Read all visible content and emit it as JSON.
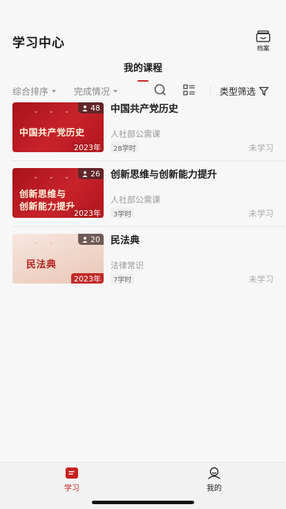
{
  "header": {
    "title": "学习中心",
    "archive_label": "档案"
  },
  "tabs": [
    {
      "label": "我的课程",
      "active": true
    }
  ],
  "filters": {
    "sort_label": "综合排序",
    "status_label": "完成情况",
    "type_filter_label": "类型筛选"
  },
  "courses": [
    {
      "title": "中国共产党历史",
      "thumb_text": "中国共产党历史",
      "category": "人社部公需课",
      "hours": "28学时",
      "status": "未学习",
      "learners": "48",
      "year": "2023年"
    },
    {
      "title": "创新思维与创新能力提升",
      "thumb_text_line1": "创新思维与",
      "thumb_text_line2": "创新能力提升",
      "category": "人社部公需课",
      "hours": "3学时",
      "status": "未学习",
      "learners": "26",
      "year": "2023年"
    },
    {
      "title": "民法典",
      "thumb_text": "民法典",
      "category": "法律常识",
      "hours": "7学时",
      "status": "未学习",
      "learners": "20",
      "year": "2023年"
    }
  ],
  "tabbar": {
    "learn_label": "学习",
    "mine_label": "我的"
  },
  "colors": {
    "accent": "#c8201f",
    "background": "#f7f7f7"
  }
}
